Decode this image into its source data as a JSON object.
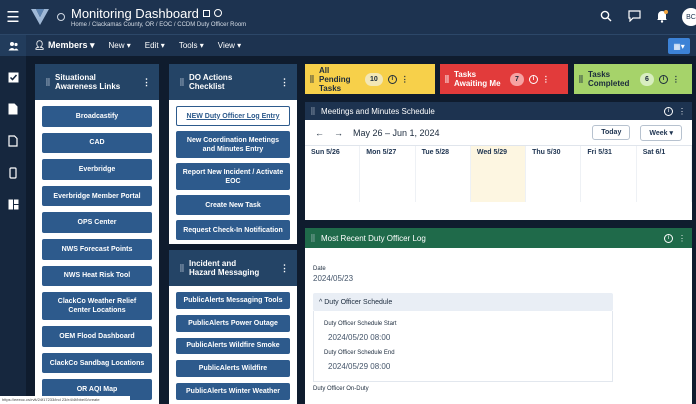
{
  "header": {
    "title": "Monitoring Dashboard",
    "breadcrumb": "Home / Clackamas County, OR / EOC / CCDM Duty Officer Room",
    "avatar_initials": "BC"
  },
  "toolbar": {
    "members": "Members",
    "new": "New",
    "edit": "Edit",
    "tools": "Tools",
    "view": "View"
  },
  "situational": {
    "title": "Situational Awareness Links",
    "links": [
      "Broadcastify",
      "CAD",
      "Everbridge",
      "Everbridge Member Portal",
      "OPS Center",
      "NWS Forecast Points",
      "NWS Heat Risk Tool",
      "ClackCo Weather Relief Center Locations",
      "OEM Flood Dashboard",
      "ClackCo Sandbag Locations",
      "OR AQI Map"
    ]
  },
  "do_actions": {
    "title": "DO Actions Checklist",
    "items": [
      "NEW Duty Officer Log Entry",
      "New Coordination Meetings and Minutes Entry",
      "Report New Incident / Activate EOC",
      "Create New Task",
      "Request Check-In Notification"
    ]
  },
  "hazard": {
    "title": "Incident and Hazard Messaging",
    "items": [
      "PublicAlerts Messaging Tools",
      "PublicAlerts Power Outage",
      "PublicAlerts Wildfire Smoke",
      "PublicAlerts Wildfire",
      "PublicAlerts Winter Weather"
    ]
  },
  "stats": [
    {
      "label": "All Pending Tasks",
      "count": "10",
      "bg": "#f7d04a",
      "badge": "#f3e7b6"
    },
    {
      "label": "Tasks Awaiting Me",
      "count": "7",
      "bg": "#e23b3b",
      "badge": "#f6a2a2"
    },
    {
      "label": "Tasks Completed",
      "count": "6",
      "bg": "#a6d36a",
      "badge": "#d8eec0"
    }
  ],
  "meetings": {
    "title": "Meetings and Minutes Schedule",
    "range": "May 26 – Jun 1, 2024",
    "today": "Today",
    "view": "Week",
    "days": [
      "Sun 5/26",
      "Mon 5/27",
      "Tue 5/28",
      "Wed 5/29",
      "Thu 5/30",
      "Fri 5/31",
      "Sat 6/1"
    ]
  },
  "log": {
    "title": "Most Recent Duty Officer Log",
    "date_label": "Date",
    "date_value": "2024/05/23",
    "schedule_section": "Duty Officer Schedule",
    "start_label": "Duty Officer Schedule Start",
    "start_value": "2024/05/20 08:00",
    "end_label": "Duty Officer Schedule End",
    "end_value": "2024/05/29 08:00",
    "onduty_label": "Duty Officer On-Duty"
  },
  "status_url": "https://eeeoc.cs/rvlt/24f17233/ind 23/e4/4f/bbe/0/create"
}
